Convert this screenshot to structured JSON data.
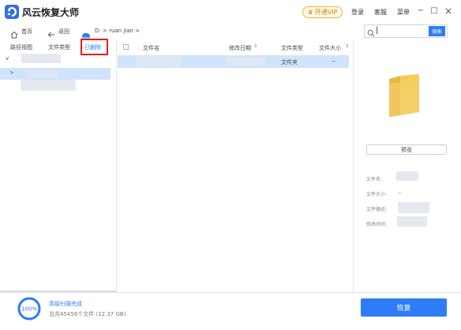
{
  "app": {
    "title": "风云恢复大师"
  },
  "topbar": {
    "vip_label": "开通VIP",
    "login_label": "登录",
    "support_label": "客服",
    "menu_label": "菜单",
    "minimize_glyph": "−",
    "maximize_glyph": "□",
    "close_glyph": "×"
  },
  "nav": {
    "home_label": "首页",
    "back_label": "返回",
    "path": "D: > ruan jian >"
  },
  "search": {
    "cursor": "|",
    "button_label": "搜索"
  },
  "left_tabs": [
    "路径视图",
    "文件类型",
    "已删除"
  ],
  "tree": {
    "expand_glyph": "v",
    "item_glyph": ">"
  },
  "table": {
    "columns": [
      "文件名",
      "修改日期",
      "文件类型",
      "文件大小"
    ],
    "rows": [
      {
        "type": "文件夹",
        "size": "--"
      }
    ]
  },
  "info_panel": {
    "preview_label": "预览",
    "labels": [
      "文件名:",
      "文件大小:",
      "文件路径:",
      "修改时间:"
    ],
    "size_value": "--"
  },
  "status": {
    "progress_percent": 100,
    "progress_label": "100%",
    "scan_text": "高级扫描完成",
    "summary_text": "总共45456个文件 (12.37 GB)"
  },
  "recover_label": "恢复",
  "colors": {
    "accent": "#2e7cf6",
    "highlight": "#e41e1e",
    "selected_row": "#cfe3fb"
  }
}
